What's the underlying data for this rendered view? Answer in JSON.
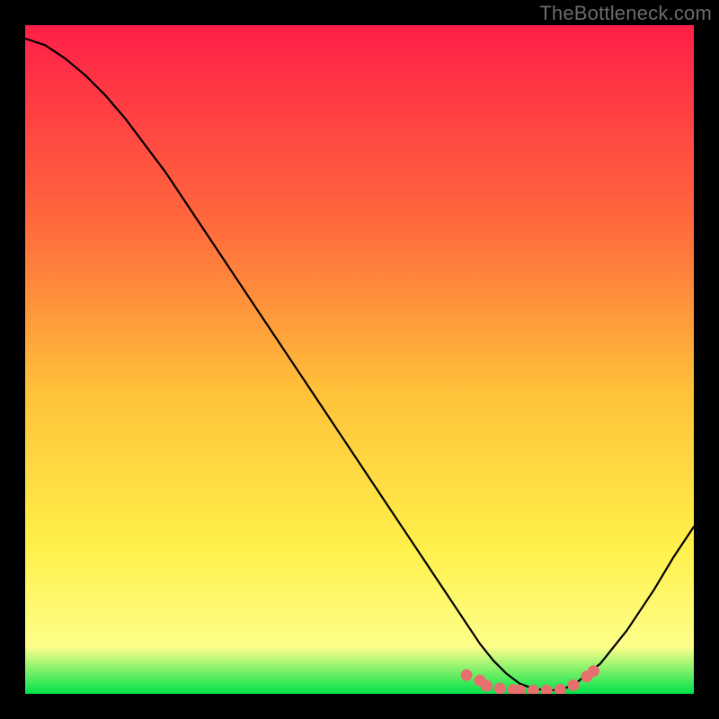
{
  "watermark": "TheBottleneck.com",
  "colors": {
    "black": "#000000",
    "grad_top": "#ff1f48",
    "grad_mid1": "#ff6a3c",
    "grad_mid2": "#ffc23a",
    "grad_mid3": "#fff04a",
    "grad_low": "#fdff8a",
    "grad_base": "#00e24a",
    "curve": "#000000",
    "marker_fill": "#e96f6f",
    "marker_stroke": "#c84f4f"
  },
  "chart_data": {
    "type": "line",
    "title": "",
    "xlabel": "",
    "ylabel": "",
    "xlim": [
      0,
      100
    ],
    "ylim": [
      0,
      100
    ],
    "series": [
      {
        "name": "bottleneck-curve",
        "x": [
          0,
          3,
          6,
          9,
          12,
          15,
          18,
          21,
          24,
          27,
          30,
          33,
          36,
          39,
          42,
          45,
          48,
          51,
          54,
          57,
          60,
          63,
          66,
          68,
          70,
          72,
          74,
          76,
          78,
          80,
          82,
          86,
          90,
          94,
          97,
          100
        ],
        "y": [
          98,
          97,
          95,
          92.5,
          89.5,
          86,
          82,
          78,
          73.5,
          69,
          64.5,
          60,
          55.5,
          51,
          46.5,
          42,
          37.5,
          33,
          28.5,
          24,
          19.5,
          15,
          10.5,
          7.5,
          5,
          3,
          1.5,
          0.8,
          0.5,
          0.6,
          1.3,
          4.5,
          9.5,
          15.5,
          20.5,
          25
        ]
      }
    ],
    "markers": {
      "name": "highlight-minimum",
      "x": [
        66,
        68,
        69,
        71,
        73,
        74,
        76,
        78,
        80,
        82,
        84,
        85
      ],
      "y": [
        2.8,
        2.0,
        1.2,
        0.8,
        0.6,
        0.5,
        0.5,
        0.5,
        0.6,
        1.3,
        2.6,
        3.4
      ]
    }
  }
}
